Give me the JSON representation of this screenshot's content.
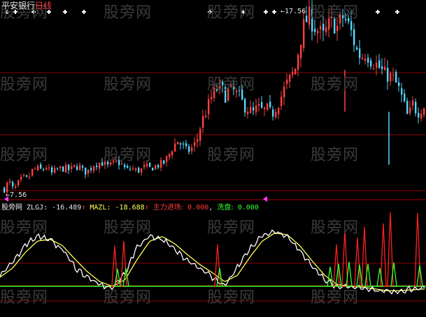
{
  "stock_name": "平安银行",
  "period": "日线",
  "price_high_label": "17.56",
  "price_low_label": "7.56",
  "indicator": {
    "name": "股旁网",
    "zlgj_label": "ZLGJ:",
    "zlgj_value": "-16.489",
    "mazl_label": "MAZL:",
    "mazl_value": "-18.688",
    "arrow": "↑",
    "zljc_label": "主力进场:",
    "zljc_value": "0.000",
    "xp_label": "洗盘:",
    "xp_value": "0.000"
  },
  "watermark": "股旁网",
  "colors": {
    "background": "#000000",
    "up_candle": "#ff4040",
    "down_candle": "#54d8ff",
    "grid": "#8b0000",
    "zlgj_line": "#ffffff",
    "mazl_line": "#ffff55",
    "zljc_spike": "#ff2020",
    "xp_spike": "#33ff33",
    "signal_mark": "#ffffff",
    "pointer_mark": "#ff40ff"
  },
  "chart_data": {
    "type": "candlestick",
    "price_range": [
      7.56,
      17.56
    ],
    "signal_marks": "white plus markers above candles at buy signals",
    "price_path": [
      8.0,
      8.4,
      7.9,
      8.3,
      8.6,
      8.5,
      9.0,
      9.1,
      9.0,
      9.2,
      8.8,
      9.0,
      9.1,
      9.1,
      9.0,
      9.2,
      9.2,
      8.9,
      9.0,
      9.3,
      9.4,
      9.4,
      9.2,
      9.3,
      9.5,
      9.3,
      9.0,
      9.1,
      9.0,
      9.0,
      9.2,
      9.1,
      9.2,
      9.3,
      9.4,
      9.8,
      10.3,
      10.6,
      10.3,
      10.0,
      10.2,
      10.6,
      11.6,
      12.2,
      12.9,
      13.3,
      13.6,
      13.0,
      13.4,
      13.2,
      13.0,
      12.5,
      12.3,
      12.1,
      12.4,
      12.2,
      12.3,
      12.0,
      12.5,
      13.0,
      13.6,
      14.0,
      14.5,
      16.0,
      17.0,
      17.3,
      16.8,
      16.5,
      16.2,
      16.8,
      17.0,
      16.7,
      17.3,
      17.0,
      16.4,
      15.5,
      15.1,
      15.4,
      15.0,
      14.8,
      14.5,
      14.2,
      14.1,
      13.9,
      13.4,
      12.7,
      11.8,
      12.6,
      12.1,
      12.4,
      12.6
    ],
    "zlgj_path": [
      -18.5,
      -17.0,
      -15.0,
      -14.0,
      -14.5,
      -15.5,
      -17.5,
      -18.6,
      -19.5,
      -19.8,
      -18.2,
      -15.2,
      -14.0,
      -14.4,
      -15.6,
      -16.6,
      -17.6,
      -18.6,
      -19.6,
      -17.6,
      -15.5,
      -14.0,
      -13.5,
      -14.2,
      -15.6,
      -17.3,
      -18.9,
      -19.6,
      -19.7,
      -19.7,
      -20.0,
      -20.2,
      -20.1,
      -19.9,
      -19.9
    ],
    "mazl_path": [
      -18.6,
      -17.6,
      -15.9,
      -14.6,
      -14.4,
      -15.1,
      -16.6,
      -18.0,
      -19.1,
      -19.6,
      -18.9,
      -16.6,
      -14.6,
      -14.1,
      -14.9,
      -16.1,
      -17.2,
      -18.1,
      -19.1,
      -18.4,
      -16.4,
      -14.6,
      -13.7,
      -13.9,
      -15.1,
      -16.8,
      -18.4,
      -19.4,
      -19.6,
      -19.7,
      -19.9,
      -20.1,
      -20.1,
      -20.0,
      -19.9
    ]
  }
}
